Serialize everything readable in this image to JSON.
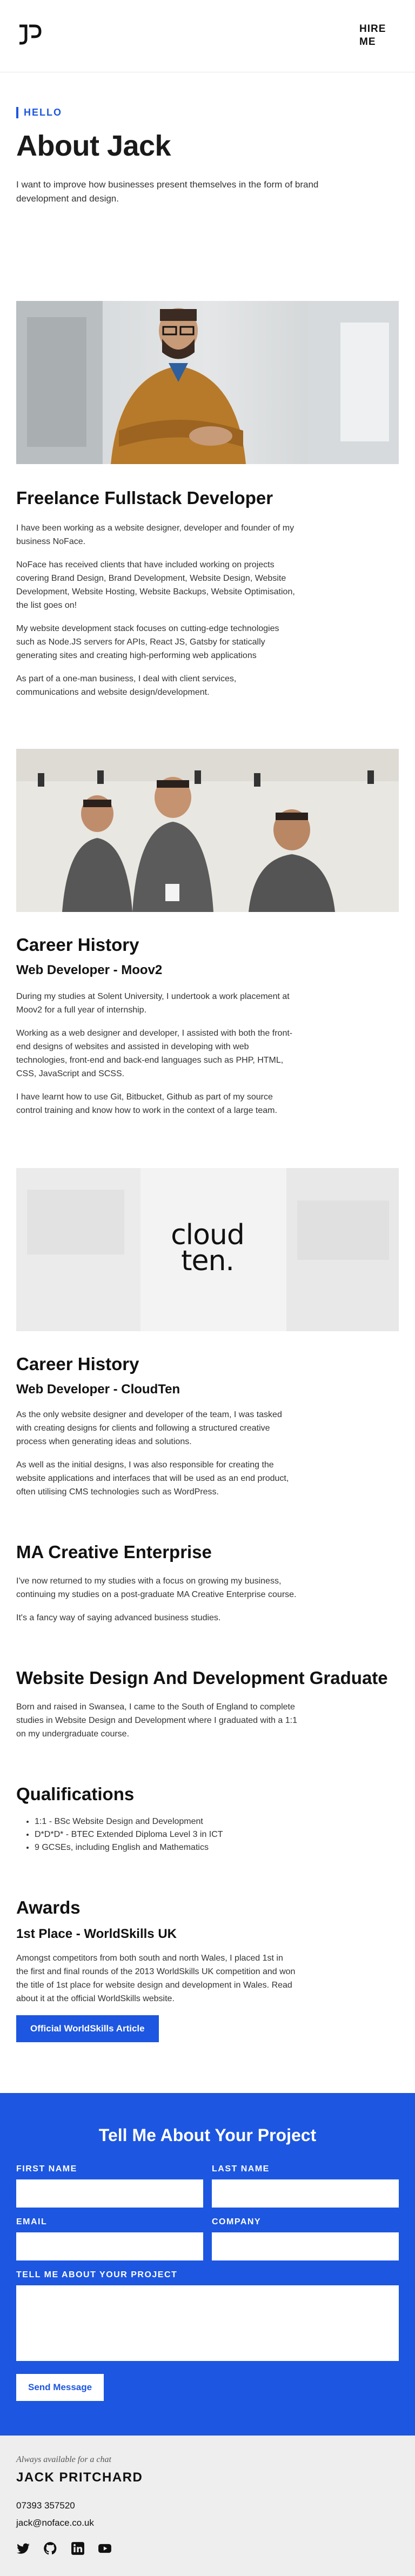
{
  "header": {
    "logo_alt": "JP",
    "hire_label_line1": "HIRE",
    "hire_label_line2": "ME"
  },
  "hero": {
    "tag": "HELLO",
    "title": "About Jack",
    "intro": "I want to improve how businesses present themselves in the form of brand development and design."
  },
  "freelance": {
    "title": "Freelance Fullstack Developer",
    "p1": "I have been working as a website designer, developer and founder of my business NoFace.",
    "p2": "NoFace has received clients that have included working on projects covering Brand Design, Brand Development, Website Design, Website Development, Website Hosting, Website Backups, Website Optimisation, the list goes on!",
    "p3": "My website development stack focuses on cutting-edge technologies such as Node.JS servers for APIs, React JS, Gatsby for statically generating sites and creating high-performing web applications",
    "p4": "As part of a one-man business, I deal with client services, communications and website design/development."
  },
  "career1": {
    "title": "Career History",
    "role": "Web Developer - Moov2",
    "p1": "During my studies at Solent University, I undertook a work placement at Moov2 for a full year of internship.",
    "p2": "Working as a web designer and developer, I assisted with both the front-end designs of websites and assisted in developing with web technologies, front-end and back-end languages such as PHP, HTML, CSS, JavaScript and SCSS.",
    "p3": "I have learnt how to use Git, Bitbucket, Github as part of my source control training and know how to work in the context of a large team."
  },
  "cloudten_logo": {
    "line1": "cloud",
    "line2": "ten."
  },
  "career2": {
    "title": "Career History",
    "role": "Web Developer - CloudTen",
    "p1": "As the only website designer and developer of the team, I was tasked with creating designs for clients and following a structured creative process when generating ideas and solutions.",
    "p2": "As well as the initial designs, I was also responsible for creating the website applications and interfaces that will be used as an end product, often utilising CMS technologies such as WordPress."
  },
  "ma": {
    "title": "MA Creative Enterprise",
    "p1": "I've now returned to my studies with a focus on growing my business, continuing my studies on a post-graduate MA Creative Enterprise course.",
    "p2": "It's a fancy way of saying advanced business studies."
  },
  "graduate": {
    "title": "Website Design And Development Graduate",
    "p1": "Born and raised in Swansea, I came to the South of England to complete studies in Website Design and Development where I graduated with a 1:1 on my undergraduate course."
  },
  "qualifications": {
    "title": "Qualifications",
    "items": [
      "1:1 - BSc Website Design and Development",
      "D*D*D* - BTEC Extended Diploma Level 3 in ICT",
      "9 GCSEs, including English and Mathematics"
    ]
  },
  "awards": {
    "title": "Awards",
    "subtitle": "1st Place - WorldSkills UK",
    "p1": "Amongst competitors from both south and north Wales, I placed 1st in the first and final rounds of the 2013 WorldSkills UK competition and won the title of 1st place for website design and development in Wales. Read about it at the official WorldSkills website.",
    "button": "Official WorldSkills Article"
  },
  "contact": {
    "title": "Tell Me About Your Project",
    "first_name": "FIRST NAME",
    "last_name": "LAST NAME",
    "email": "EMAIL",
    "company": "COMPANY",
    "project": "TELL ME ABOUT YOUR PROJECT",
    "submit": "Send Message"
  },
  "footer": {
    "availability": "Always available for a chat",
    "name": "JACK PRITCHARD",
    "phone": "07393 357520",
    "email": "jack@noface.co.uk"
  },
  "icons": {
    "social": [
      "twitter-icon",
      "github-icon",
      "linkedin-icon",
      "youtube-icon"
    ]
  },
  "colors": {
    "accent": "#1d56e0",
    "footer_bg": "#eeeeee"
  }
}
